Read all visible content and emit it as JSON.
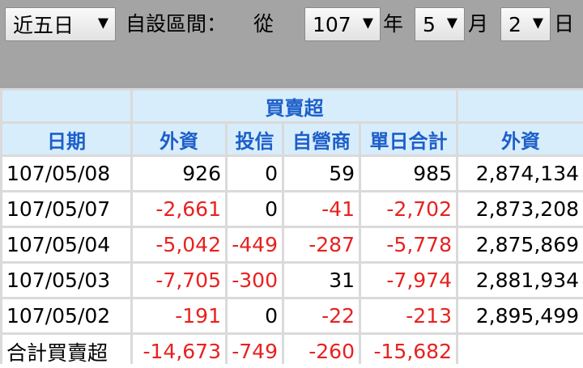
{
  "toolbar": {
    "period_select": "近五日",
    "custom_range_label": "自設區間：",
    "from_label": "從",
    "year_select": "107",
    "year_label": "年",
    "month_select": "5",
    "month_label": "月",
    "day_select": "2",
    "day_label": "日",
    "dropdown_arrow": "▼"
  },
  "table": {
    "group_header": "買賣超",
    "headers": {
      "date": "日期",
      "foreign": "外資",
      "trust": "投信",
      "dealer": "自營商",
      "daily_total": "單日合計",
      "foreign_holdings": "外資"
    },
    "rows": [
      {
        "date": "107/05/08",
        "foreign": "926",
        "trust": "0",
        "dealer": "59",
        "total": "985",
        "holdings": "2,874,134"
      },
      {
        "date": "107/05/07",
        "foreign": "-2,661",
        "trust": "0",
        "dealer": "-41",
        "total": "-2,702",
        "holdings": "2,873,208"
      },
      {
        "date": "107/05/04",
        "foreign": "-5,042",
        "trust": "-449",
        "dealer": "-287",
        "total": "-5,778",
        "holdings": "2,875,869"
      },
      {
        "date": "107/05/03",
        "foreign": "-7,705",
        "trust": "-300",
        "dealer": "31",
        "total": "-7,974",
        "holdings": "2,881,934"
      },
      {
        "date": "107/05/02",
        "foreign": "-191",
        "trust": "0",
        "dealer": "-22",
        "total": "-213",
        "holdings": "2,895,499"
      }
    ],
    "summary": {
      "label": "合計買賣超",
      "foreign": "-14,673",
      "trust": "-749",
      "dealer": "-260",
      "total": "-15,682"
    }
  },
  "colors": {
    "header_bg": "#d8edfc",
    "header_text": "#1d5fc9",
    "negative": "#e8211f",
    "toolbar_bg": "#a4a4a4",
    "grid_line": "#dadada"
  }
}
